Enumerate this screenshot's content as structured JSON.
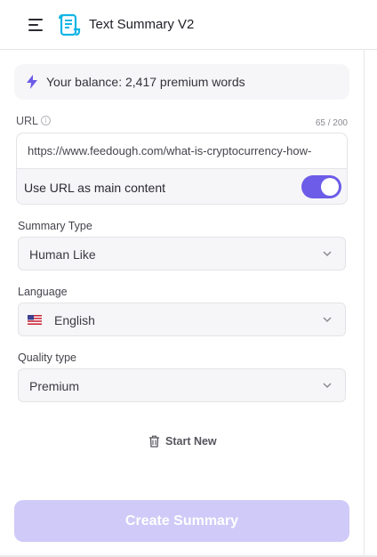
{
  "header": {
    "title": "Text Summary V2",
    "menu_icon": "hamburger-menu-icon",
    "logo_icon": "scroll-document-icon"
  },
  "balance": {
    "icon": "lightning-bolt-icon",
    "text": "Your balance: 2,417 premium words"
  },
  "url_field": {
    "label": "URL",
    "info_icon": "i",
    "char_count": "65 / 200",
    "value": "https://www.feedough.com/what-is-cryptocurrency-how-",
    "toggle_label": "Use URL as main content",
    "toggle_on": true
  },
  "summary_type": {
    "label": "Summary Type",
    "value": "Human Like"
  },
  "language": {
    "label": "Language",
    "value": "English",
    "flag_icon": "us-flag-icon"
  },
  "quality_type": {
    "label": "Quality type",
    "value": "Premium"
  },
  "actions": {
    "start_new_label": "Start New",
    "create_label": "Create Summary"
  },
  "colors": {
    "accent": "#6c5ce7",
    "button_disabled": "#cfcaf7",
    "panel_bg": "#f6f6f8"
  }
}
